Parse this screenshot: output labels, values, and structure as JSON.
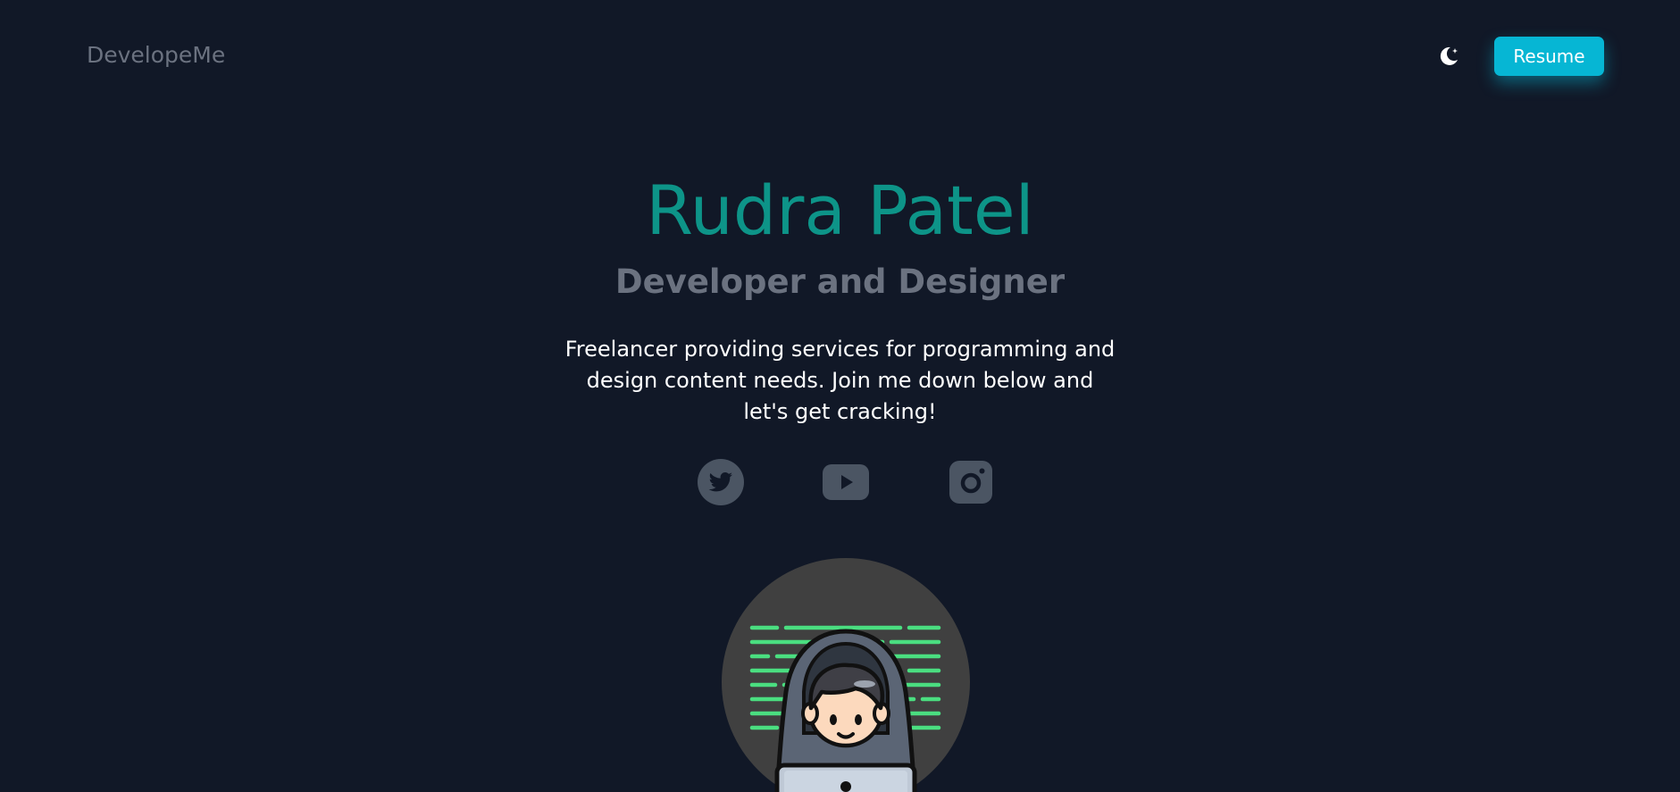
{
  "nav": {
    "brand": "DevelopeMe",
    "theme_icon": "moon-icon",
    "resume_label": "Resume"
  },
  "hero": {
    "name": "Rudra Patel",
    "role": "Developer and Designer",
    "description": "Freelancer providing services for programming and design content needs. Join me down below and let's get cracking!"
  },
  "socials": [
    {
      "icon": "twitter-icon"
    },
    {
      "icon": "youtube-icon"
    },
    {
      "icon": "instagram-icon"
    }
  ],
  "colors": {
    "background": "#111827",
    "accent": "#06b6d4",
    "name": "#0d9488",
    "muted": "#6b7280",
    "social_icon": "#4b5563",
    "code_lines": "#4ade80"
  },
  "illustration": {
    "icon": "hooded-developer-illustration"
  }
}
